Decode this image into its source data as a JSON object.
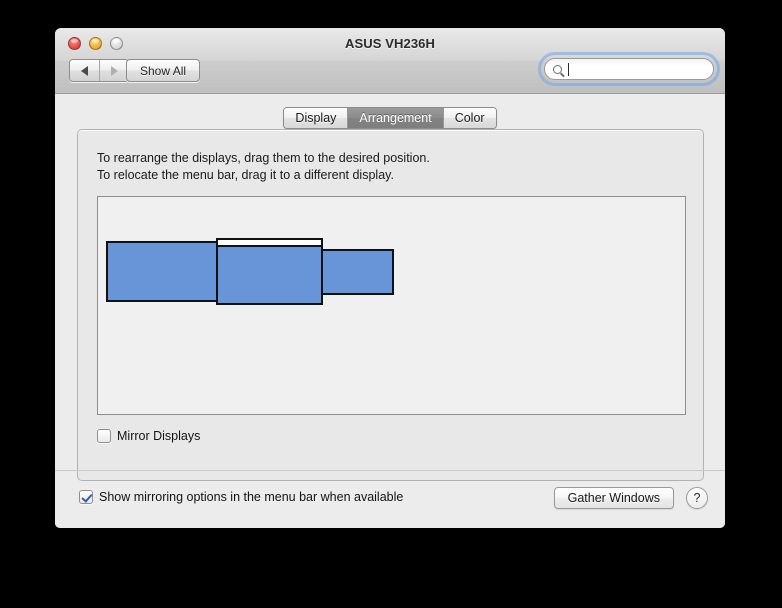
{
  "window": {
    "title": "ASUS VH236H",
    "traffic_lights": [
      {
        "name": "close",
        "color": "#e24b3e"
      },
      {
        "name": "minimize",
        "color": "#edab2b"
      },
      {
        "name": "zoom",
        "color": "#d5d5d5"
      }
    ]
  },
  "toolbar": {
    "back_label": "◀",
    "forward_label": "▶",
    "show_all_label": "Show All",
    "search": {
      "value": "",
      "placeholder": ""
    }
  },
  "tabs": [
    {
      "label": "Display",
      "active": false
    },
    {
      "label": "Arrangement",
      "active": true
    },
    {
      "label": "Color",
      "active": false
    }
  ],
  "panel": {
    "instruction_line1": "To rearrange the displays, drag them to the desired position.",
    "instruction_line2": "To relocate the menu bar, drag it to a different display.",
    "displays": [
      {
        "name": "display-left",
        "has_menu_bar": false,
        "color": "#6795d8"
      },
      {
        "name": "display-center",
        "has_menu_bar": true,
        "color": "#6795d8"
      },
      {
        "name": "display-right",
        "has_menu_bar": false,
        "color": "#6795d8"
      }
    ],
    "mirror_displays": {
      "label": "Mirror Displays",
      "checked": false
    }
  },
  "footer": {
    "show_mirroring_options": {
      "label": "Show mirroring options in the menu bar when available",
      "checked": true
    },
    "gather_windows_label": "Gather Windows",
    "help_label": "?"
  },
  "colors": {
    "display_blue": "#6795d8",
    "accent_focus_ring": "#6ea5eb",
    "checkmark": "#2f5fa8",
    "desktop": "#000000"
  }
}
